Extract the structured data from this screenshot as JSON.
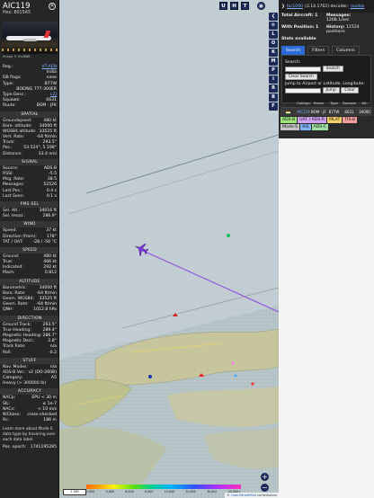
{
  "info": {
    "callsign": "AIC119",
    "hex": "Hex: 8015A5",
    "photo_credit": "Image © Kivi888",
    "reg": {
      "label": "Reg.:",
      "value": "VT-AEN"
    },
    "country": {
      "label": "",
      "value": "India"
    },
    "db_flags": {
      "label": "DB flags:",
      "value": "none"
    },
    "type": {
      "label": "Type:",
      "value": "B77W"
    },
    "type_name": "BOEING 777-300ER",
    "type_desc": {
      "label": "Type Desc.:",
      "value": "L2J"
    },
    "squawk": {
      "label": "Squawk:",
      "value": "6631"
    },
    "route": {
      "label": "Route:",
      "value": "BOM - JFK"
    },
    "spatial": {
      "title": "SPATIAL",
      "rows": [
        {
          "k": "Groundspeed:",
          "v": "480 kt"
        },
        {
          "k": "Baro. altitude:",
          "v": "34000 ft"
        },
        {
          "k": "WGS84 altitude:",
          "v": "33525 ft"
        },
        {
          "k": "Vert. Rate:",
          "v": "-64 ft/min"
        },
        {
          "k": "Track:",
          "v": "293.5°"
        },
        {
          "k": "Pos.:",
          "v": "53.524°, 5.198°"
        },
        {
          "k": "Distance:",
          "v": "33.4 nmi"
        }
      ]
    },
    "signal": {
      "title": "SIGNAL",
      "rows": [
        {
          "k": "Source:",
          "v": "ADS-B"
        },
        {
          "k": "RSSI:",
          "v": "-5.5"
        },
        {
          "k": "Msg. Rate:",
          "v": "38.5"
        },
        {
          "k": "Messages:",
          "v": "52526"
        },
        {
          "k": "Last Pos.:",
          "v": "0.4 s"
        },
        {
          "k": "Last Seen:",
          "v": "0.1 s"
        }
      ]
    },
    "fms": {
      "title": "FMS SEL",
      "rows": [
        {
          "k": "Sel. Alt.:",
          "v": "34016 ft"
        },
        {
          "k": "Sel. Head.:",
          "v": "286.9°"
        }
      ]
    },
    "wind": {
      "title": "WIND",
      "rows": [
        {
          "k": "Speed:",
          "v": "37 kt"
        },
        {
          "k": "Direction (from):",
          "v": "178°"
        },
        {
          "k": "TAT / OAT:",
          "v": "-28 / -56 °C"
        }
      ]
    },
    "speed": {
      "title": "SPEED",
      "rows": [
        {
          "k": "Ground:",
          "v": "480 kt"
        },
        {
          "k": "True:",
          "v": "466 kt"
        },
        {
          "k": "Indicated:",
          "v": "292 kt"
        },
        {
          "k": "Mach:",
          "v": "0.812"
        }
      ]
    },
    "altitude": {
      "title": "ALTITUDE",
      "rows": [
        {
          "k": "Barometric:",
          "v": "34000 ft"
        },
        {
          "k": "Baro. Rate:",
          "v": "-64 ft/min"
        },
        {
          "k": "Geom. WGS84:",
          "v": "33525 ft"
        },
        {
          "k": "Geom. Rate:",
          "v": "-64 ft/min"
        },
        {
          "k": "QNH:",
          "v": "1012.8 hPa"
        }
      ]
    },
    "direction": {
      "title": "DIRECTION",
      "rows": [
        {
          "k": "Ground Track:",
          "v": "293.5°"
        },
        {
          "k": "True Heading:",
          "v": "289.4°"
        },
        {
          "k": "Magnetic Heading:",
          "v": "286.7°"
        },
        {
          "k": "Magnetic Decl.:",
          "v": "2.8°"
        },
        {
          "k": "Track Rate:",
          "v": "n/a"
        },
        {
          "k": "Roll:",
          "v": "-0.2"
        }
      ]
    },
    "stuff": {
      "title": "STUFF",
      "rows": [
        {
          "k": "Nav. Modes:",
          "v": "n/a"
        },
        {
          "k": "ADS-B Ver.:",
          "v": "v2 (DO-260B)"
        },
        {
          "k": "Category:",
          "v": "A5"
        }
      ],
      "heavy": "Heavy (> 300000 lb)"
    },
    "accuracy": {
      "title": "ACCURACY",
      "rows": [
        {
          "k": "NACp:",
          "v": "EPU < 30 m"
        },
        {
          "k": "SIL:",
          "v": "≤ 1e-7"
        },
        {
          "k": "NACv:",
          "v": "< 10 m/s"
        },
        {
          "k": "NICbaro:",
          "v": "cross-checked"
        },
        {
          "k": "Rc:",
          "v": "186 m"
        }
      ]
    },
    "note_text": "Learn more about Mode S data type by hovering over each data label.",
    "pos_epoch": {
      "k": "Pos. epoch:",
      "v": "1741195285"
    }
  },
  "map": {
    "top_buttons": [
      "U",
      "H",
      "T"
    ],
    "colorbar_ticks": [
      "2,000",
      "4,000",
      "6,000",
      "8,000",
      "10,000",
      "20,000",
      "30,000",
      "40,000+"
    ],
    "scale_label": "1 NM",
    "attribution_prefix": "© ",
    "attribution_link": "OpenStreetMap",
    "attribution_suffix": " contributors",
    "zoom_in": "+",
    "zoom_out": "−"
  },
  "strip_buttons": [
    "L",
    "O",
    "K",
    "M",
    "P",
    "I",
    "R",
    "B",
    "F"
  ],
  "right": {
    "link": "tar1090",
    "version": "(3.14.1762) decoder:",
    "decoder_link": "readsb",
    "total_aircraft_label": "Total Aircraft:",
    "total_aircraft_value": "1",
    "messages_label": "Messages:",
    "messages_value": "1268.1/sec",
    "with_pos_label": "With Position:",
    "with_pos_value": "1",
    "history_label": "History:",
    "history_value": "11524 positions",
    "stats_label": "Stats available",
    "tabs": [
      "Search",
      "Filters",
      "Columns"
    ],
    "search_label": "Search:",
    "search_button": "Search",
    "clear_search": "Clear Search",
    "jump_label": "Jump to Airport or Latitude, Longitude:",
    "jump_button": "Jump",
    "clear_button": "Clear",
    "table_headers": [
      "Callsign",
      "Route",
      "Type",
      "Squawk",
      "Alt."
    ],
    "table_row": [
      "AIC119",
      "BOM - JFK",
      "B77W",
      "6631",
      "34000"
    ],
    "legend": [
      {
        "label": "ADS-B",
        "color": "#9ee37d"
      },
      {
        "label": "UAT / ADS-R",
        "color": "#d2a4f0"
      },
      {
        "label": "MLAT",
        "color": "#f4d068"
      },
      {
        "label": "TIS-B",
        "color": "#f59d9d"
      },
      {
        "label": "Mode-S",
        "color": "#c4c4c4"
      },
      {
        "label": "AIS",
        "color": "#7fb2ff"
      },
      {
        "label": "ADS-C",
        "color": "#a0e0a0"
      }
    ]
  }
}
